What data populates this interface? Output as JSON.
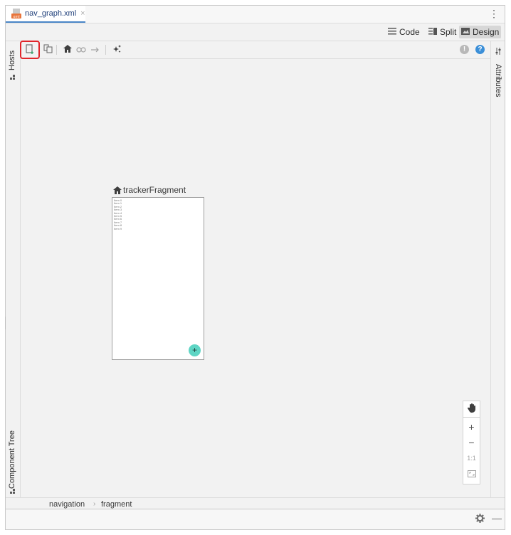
{
  "tab": {
    "label": "nav_graph.xml",
    "close": "×"
  },
  "modes": {
    "code": "Code",
    "split": "Split",
    "design": "Design"
  },
  "icons": {
    "kebab": "more-vertical-icon",
    "new_destination": "new-destination-icon",
    "nested_graph": "nested-graph-icon",
    "home": "home-icon",
    "link": "link-icon",
    "action": "arrow-right-icon",
    "magic": "sparkle-icon",
    "warning": "warning-icon",
    "help": "help-icon",
    "hand": "hand-icon",
    "settings": "gear-icon"
  },
  "side_panels": {
    "hosts": "Hosts",
    "component_tree": "Component Tree",
    "attributes": "Attributes"
  },
  "fragment": {
    "name": "trackerFragment",
    "items": [
      "Item 0",
      "Item 1",
      "Item 2",
      "Item 3",
      "Item 4",
      "Item 5",
      "Item 6",
      "Item 7",
      "Item 8",
      "Item 9"
    ],
    "fab": "+"
  },
  "zoom": {
    "in": "+",
    "out": "−",
    "actual": "1:1"
  },
  "breadcrumb": {
    "items": [
      "navigation",
      "fragment"
    ],
    "separator": "›"
  },
  "colors": {
    "accent": "#4a86c7",
    "highlight": "#e0262b",
    "fab": "#5ed5c4",
    "help": "#3b8fd8"
  }
}
